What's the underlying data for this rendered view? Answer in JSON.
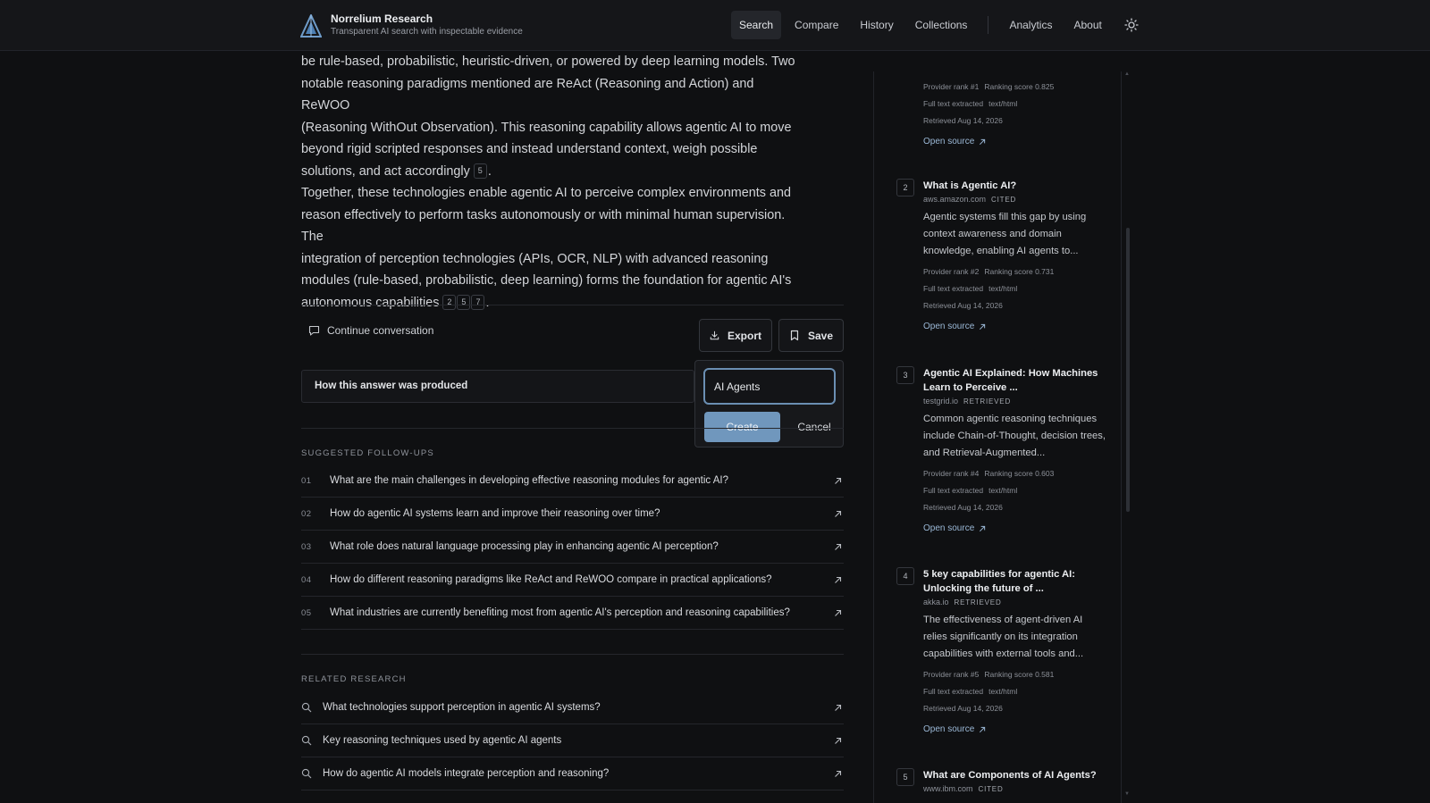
{
  "brand": {
    "title": "Norrelium Research",
    "subtitle": "Transparent AI search with inspectable evidence"
  },
  "nav": {
    "search": "Search",
    "compare": "Compare",
    "history": "History",
    "collections": "Collections",
    "analytics": "Analytics",
    "about": "About"
  },
  "answer": {
    "para1_lines": [
      "be rule-based, probabilistic, heuristic-driven, or powered by deep learning models. Two",
      "notable reasoning paradigms mentioned are ReAct (Reasoning and Action) and ReWOO",
      "(Reasoning WithOut Observation). This reasoning capability allows agentic AI to move",
      "beyond rigid scripted responses and instead understand context, weigh possible",
      "solutions, and act accordingly"
    ],
    "para1_cites": [
      "5"
    ],
    "para2_lines": [
      "Together, these technologies enable agentic AI to perceive complex environments and",
      "reason effectively to perform tasks autonomously or with minimal human supervision. The",
      "integration of perception technologies (APIs, OCR, NLP) with advanced reasoning",
      "modules (rule-based, probabilistic, deep learning) forms the foundation for agentic AI's",
      "autonomous capabilities"
    ],
    "para2_cites": [
      "2",
      "5",
      "7"
    ]
  },
  "actions": {
    "continue": "Continue conversation",
    "export": "Export",
    "save": "Save"
  },
  "produced": {
    "label": "How this answer was produced"
  },
  "collection_popover": {
    "input_value": "AI Agents",
    "create": "Create",
    "cancel": "Cancel"
  },
  "followups": {
    "heading": "SUGGESTED FOLLOW-UPS",
    "items": [
      {
        "num": "01",
        "text": "What are the main challenges in developing effective reasoning modules for agentic AI?"
      },
      {
        "num": "02",
        "text": "How do agentic AI systems learn and improve their reasoning over time?"
      },
      {
        "num": "03",
        "text": "What role does natural language processing play in enhancing agentic AI perception?"
      },
      {
        "num": "04",
        "text": "How do different reasoning paradigms like ReAct and ReWOO compare in practical applications?"
      },
      {
        "num": "05",
        "text": "What industries are currently benefiting most from agentic AI's perception and reasoning capabilities?"
      }
    ]
  },
  "related": {
    "heading": "RELATED RESEARCH",
    "items": [
      "What technologies support perception in agentic AI systems?",
      "Key reasoning techniques used by agentic AI agents",
      "How do agentic AI models integrate perception and reasoning?"
    ]
  },
  "sources": {
    "partial": {
      "rank": "Provider rank #1",
      "score": "Ranking score 0.825",
      "fulltext": "Full text extracted",
      "mime": "text/html",
      "retrieved": "Retrieved Aug 14, 2026",
      "open": "Open source"
    },
    "items": [
      {
        "idx": "2",
        "title": "What is Agentic AI?",
        "domain": "aws.amazon.com",
        "tag": "CITED",
        "snippet": "Agentic systems fill this gap by using context awareness and domain knowledge, enabling AI agents to...",
        "rank": "Provider rank #2",
        "score": "Ranking score 0.731",
        "fulltext": "Full text extracted",
        "mime": "text/html",
        "retrieved": "Retrieved Aug 14, 2026",
        "open": "Open source"
      },
      {
        "idx": "3",
        "title": "Agentic AI Explained: How Machines Learn to Perceive ...",
        "domain": "testgrid.io",
        "tag": "RETRIEVED",
        "snippet": "Common agentic reasoning techniques include Chain-of-Thought, decision trees, and Retrieval-Augmented...",
        "rank": "Provider rank #4",
        "score": "Ranking score 0.603",
        "fulltext": "Full text extracted",
        "mime": "text/html",
        "retrieved": "Retrieved Aug 14, 2026",
        "open": "Open source"
      },
      {
        "idx": "4",
        "title": "5 key capabilities for agentic AI: Unlocking the future of ...",
        "domain": "akka.io",
        "tag": "RETRIEVED",
        "snippet": "The effectiveness of agent-driven AI relies significantly on its integration capabilities with external tools and...",
        "rank": "Provider rank #5",
        "score": "Ranking score 0.581",
        "fulltext": "Full text extracted",
        "mime": "text/html",
        "retrieved": "Retrieved Aug 14, 2026",
        "open": "Open source"
      },
      {
        "idx": "5",
        "title": "What are Components of AI Agents?",
        "domain": "www.ibm.com",
        "tag": "CITED"
      }
    ]
  },
  "colors": {
    "accent": "#7097bd",
    "link": "#9bb8d6",
    "background": "#0f1012"
  }
}
